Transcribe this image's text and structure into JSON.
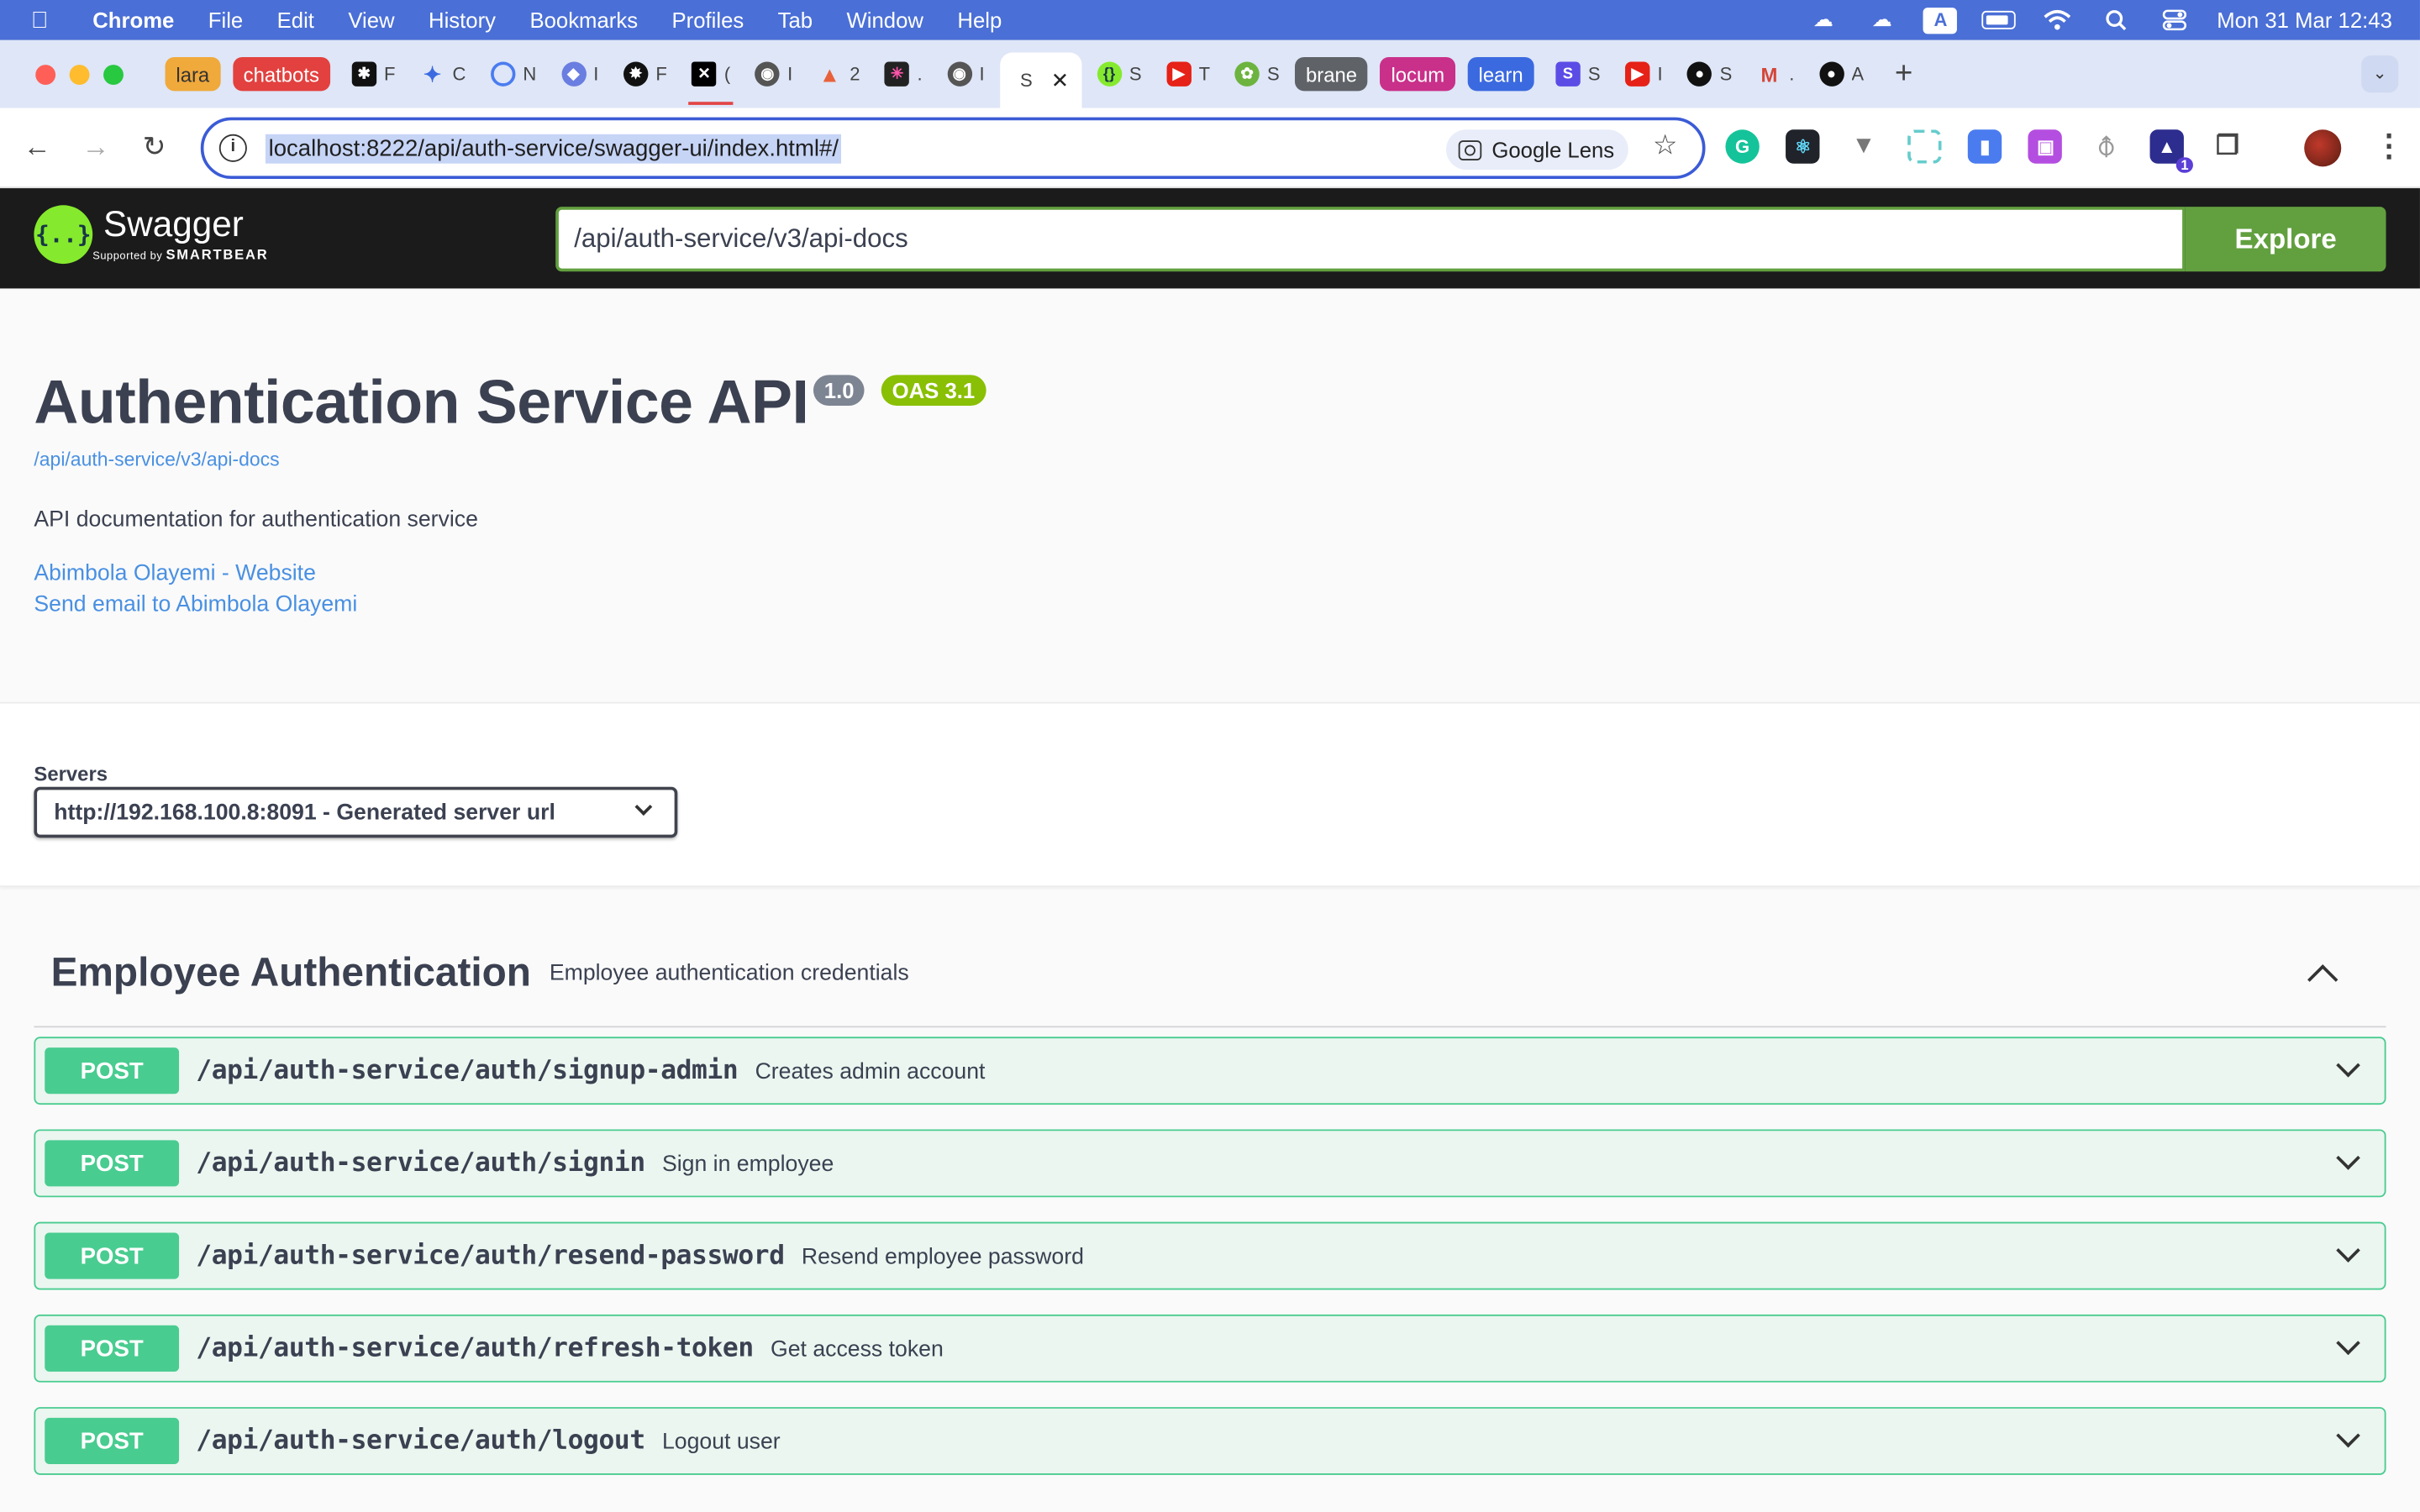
{
  "menubar": {
    "app": "Chrome",
    "items": [
      "File",
      "Edit",
      "View",
      "History",
      "Bookmarks",
      "Profiles",
      "Tab",
      "Window",
      "Help"
    ],
    "status": {
      "a_badge": "A",
      "clock": "Mon 31 Mar  12:43"
    }
  },
  "tabs": {
    "groups": {
      "lara": "lara",
      "chatbots": "chatbots",
      "brane": "brane",
      "locum": "locum",
      "learn": "learn"
    },
    "titles": {
      "t1": "F",
      "t2": "C",
      "t3": "N",
      "t4": "I",
      "t5": "F",
      "t6": "(",
      "t7": "I",
      "t8": "2",
      "t9": ".",
      "t10": "I",
      "active": "S",
      "t11": "S",
      "t12": "T",
      "t13": "S",
      "t14": "S",
      "t15": "I",
      "t16": "S",
      "t17": ".",
      "t18": "A"
    }
  },
  "toolbar": {
    "url": "localhost:8222/api/auth-service/swagger-ui/index.html#/",
    "lens_label": "Google Lens",
    "ext_badge": "1"
  },
  "swagger": {
    "brand": "Swagger",
    "supported_by": "Supported by",
    "smartbear": "SMARTBEAR",
    "search_value": "/api/auth-service/v3/api-docs",
    "explore_label": "Explore"
  },
  "info": {
    "title": "Authentication Service API",
    "version": "1.0",
    "oas": "OAS 3.1",
    "spec_link": "/api/auth-service/v3/api-docs",
    "description": "API documentation for authentication service",
    "contact_website": "Abimbola Olayemi - Website",
    "contact_email": "Send email to Abimbola Olayemi"
  },
  "servers": {
    "label": "Servers",
    "selected": "http://192.168.100.8:8091 - Generated server url"
  },
  "tag": {
    "name": "Employee Authentication",
    "description": "Employee authentication credentials",
    "operations": [
      {
        "method": "POST",
        "path": "/api/auth-service/auth/signup-admin",
        "summary": "Creates admin account"
      },
      {
        "method": "POST",
        "path": "/api/auth-service/auth/signin",
        "summary": "Sign in employee"
      },
      {
        "method": "POST",
        "path": "/api/auth-service/auth/resend-password",
        "summary": "Resend employee password"
      },
      {
        "method": "POST",
        "path": "/api/auth-service/auth/refresh-token",
        "summary": "Get access token"
      },
      {
        "method": "POST",
        "path": "/api/auth-service/auth/logout",
        "summary": "Logout user"
      }
    ]
  },
  "colors": {
    "menubar": "#4a6fd6",
    "post": "#49cc90",
    "explore": "#62a03f",
    "link": "#4990e2"
  }
}
